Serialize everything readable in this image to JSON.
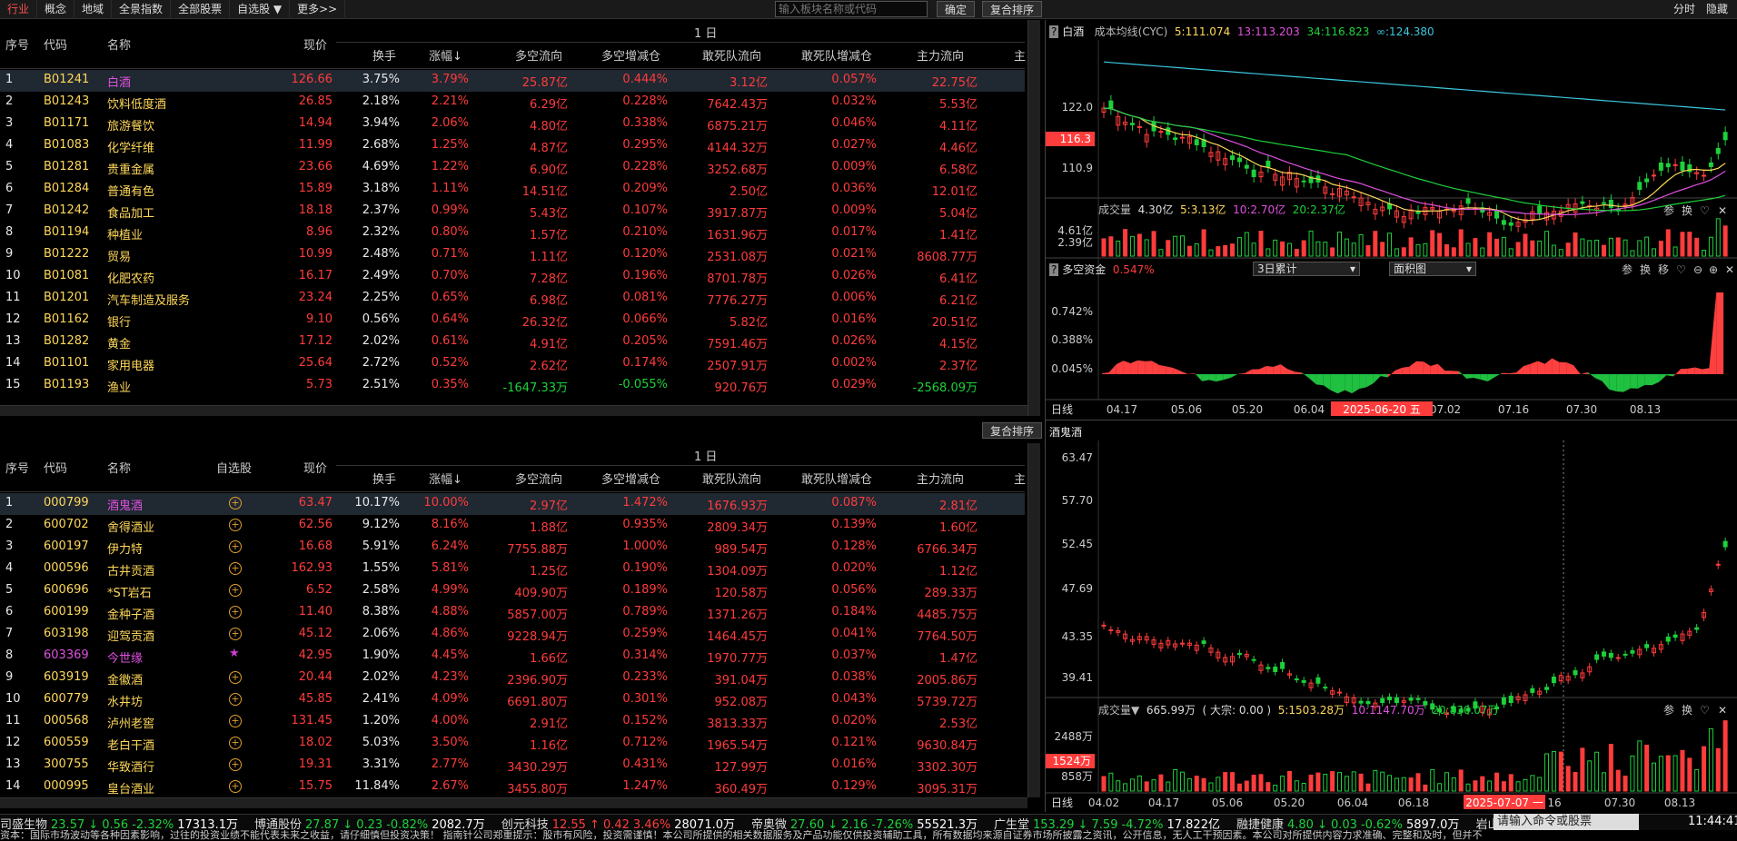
{
  "topbar": {
    "tabs": [
      "行业",
      "概念",
      "地域",
      "全景指数",
      "全部股票",
      "自选股 ▼",
      "更多>>"
    ],
    "search_placeholder": "输入板块名称或代码",
    "confirm": "确定",
    "reset_sort": "复合排序",
    "split": "分时",
    "hide": "隐藏"
  },
  "panel1": {
    "period": "1  日",
    "cols": {
      "seq": "序号",
      "code": "代码",
      "name": "名称",
      "price": "现价",
      "turnover": "换手",
      "change": "涨幅↓",
      "flow": "多空流向",
      "flow_pct": "多空增减仓",
      "dare": "敢死队流向",
      "dare_pct": "敢死队增减仓",
      "main": "主力流向",
      "extra": "主"
    },
    "rows": [
      {
        "seq": "1",
        "code": "B01241",
        "name": "白酒",
        "price": "126.66",
        "turnover": "3.75%",
        "change": "3.79%",
        "flow": "25.87亿",
        "flow_pct": "0.444%",
        "dare": "3.12亿",
        "dare_pct": "0.057%",
        "main": "22.75亿"
      },
      {
        "seq": "2",
        "code": "B01243",
        "name": "饮料低度酒",
        "price": "26.85",
        "turnover": "2.18%",
        "change": "2.21%",
        "flow": "6.29亿",
        "flow_pct": "0.228%",
        "dare": "7642.43万",
        "dare_pct": "0.032%",
        "main": "5.53亿"
      },
      {
        "seq": "3",
        "code": "B01171",
        "name": "旅游餐饮",
        "price": "14.94",
        "turnover": "3.94%",
        "change": "2.06%",
        "flow": "4.80亿",
        "flow_pct": "0.338%",
        "dare": "6875.21万",
        "dare_pct": "0.046%",
        "main": "4.11亿"
      },
      {
        "seq": "4",
        "code": "B01083",
        "name": "化学纤维",
        "price": "11.99",
        "turnover": "2.68%",
        "change": "1.25%",
        "flow": "4.87亿",
        "flow_pct": "0.295%",
        "dare": "4144.32万",
        "dare_pct": "0.027%",
        "main": "4.46亿"
      },
      {
        "seq": "5",
        "code": "B01281",
        "name": "贵重金属",
        "price": "23.66",
        "turnover": "4.69%",
        "change": "1.22%",
        "flow": "6.90亿",
        "flow_pct": "0.228%",
        "dare": "3252.68万",
        "dare_pct": "0.009%",
        "main": "6.58亿"
      },
      {
        "seq": "6",
        "code": "B01284",
        "name": "普通有色",
        "price": "15.89",
        "turnover": "3.18%",
        "change": "1.11%",
        "flow": "14.51亿",
        "flow_pct": "0.209%",
        "dare": "2.50亿",
        "dare_pct": "0.036%",
        "main": "12.01亿"
      },
      {
        "seq": "7",
        "code": "B01242",
        "name": "食品加工",
        "price": "18.18",
        "turnover": "2.37%",
        "change": "0.99%",
        "flow": "5.43亿",
        "flow_pct": "0.107%",
        "dare": "3917.87万",
        "dare_pct": "0.009%",
        "main": "5.04亿"
      },
      {
        "seq": "8",
        "code": "B01194",
        "name": "种植业",
        "price": "8.96",
        "turnover": "2.32%",
        "change": "0.80%",
        "flow": "1.57亿",
        "flow_pct": "0.210%",
        "dare": "1631.96万",
        "dare_pct": "0.017%",
        "main": "1.41亿"
      },
      {
        "seq": "9",
        "code": "B01222",
        "name": "贸易",
        "price": "10.99",
        "turnover": "2.48%",
        "change": "0.71%",
        "flow": "1.11亿",
        "flow_pct": "0.120%",
        "dare": "2531.08万",
        "dare_pct": "0.021%",
        "main": "8608.77万"
      },
      {
        "seq": "10",
        "code": "B01081",
        "name": "化肥农药",
        "price": "16.17",
        "turnover": "2.49%",
        "change": "0.70%",
        "flow": "7.28亿",
        "flow_pct": "0.196%",
        "dare": "8701.78万",
        "dare_pct": "0.026%",
        "main": "6.41亿"
      },
      {
        "seq": "11",
        "code": "B01201",
        "name": "汽车制造及服务",
        "price": "23.24",
        "turnover": "2.25%",
        "change": "0.65%",
        "flow": "6.98亿",
        "flow_pct": "0.081%",
        "dare": "7776.27万",
        "dare_pct": "0.006%",
        "main": "6.21亿"
      },
      {
        "seq": "12",
        "code": "B01162",
        "name": "银行",
        "price": "9.10",
        "turnover": "0.56%",
        "change": "0.64%",
        "flow": "26.32亿",
        "flow_pct": "0.066%",
        "dare": "5.82亿",
        "dare_pct": "0.016%",
        "main": "20.51亿"
      },
      {
        "seq": "13",
        "code": "B01282",
        "name": "黄金",
        "price": "17.12",
        "turnover": "2.02%",
        "change": "0.61%",
        "flow": "4.91亿",
        "flow_pct": "0.205%",
        "dare": "7591.46万",
        "dare_pct": "0.026%",
        "main": "4.15亿"
      },
      {
        "seq": "14",
        "code": "B01101",
        "name": "家用电器",
        "price": "25.64",
        "turnover": "2.72%",
        "change": "0.52%",
        "flow": "2.62亿",
        "flow_pct": "0.174%",
        "dare": "2507.91万",
        "dare_pct": "0.002%",
        "main": "2.37亿"
      },
      {
        "seq": "15",
        "code": "B01193",
        "name": "渔业",
        "price": "5.73",
        "turnover": "2.51%",
        "change": "0.35%",
        "flow": "-1647.33万",
        "flow_pct": "-0.055%",
        "dare": "920.76万",
        "dare_pct": "0.029%",
        "main": "-2568.09万"
      }
    ]
  },
  "panel2": {
    "reset_sort": "复合排序",
    "period": "1  日",
    "cols": {
      "seq": "序号",
      "code": "代码",
      "name": "名称",
      "watch": "自选股",
      "price": "现价",
      "turnover": "换手",
      "change": "涨幅↓",
      "flow": "多空流向",
      "flow_pct": "多空增减仓",
      "dare": "敢死队流向",
      "dare_pct": "敢死队增减仓",
      "main": "主力流向",
      "extra": "主"
    },
    "rows": [
      {
        "seq": "1",
        "code": "000799",
        "name": "酒鬼酒",
        "price": "63.47",
        "turnover": "10.17%",
        "change": "10.00%",
        "flow": "2.97亿",
        "flow_pct": "1.472%",
        "dare": "1676.93万",
        "dare_pct": "0.087%",
        "main": "2.81亿"
      },
      {
        "seq": "2",
        "code": "600702",
        "name": "舍得酒业",
        "price": "62.56",
        "turnover": "9.12%",
        "change": "8.16%",
        "flow": "1.88亿",
        "flow_pct": "0.935%",
        "dare": "2809.34万",
        "dare_pct": "0.139%",
        "main": "1.60亿"
      },
      {
        "seq": "3",
        "code": "600197",
        "name": "伊力特",
        "price": "16.68",
        "turnover": "5.91%",
        "change": "6.24%",
        "flow": "7755.88万",
        "flow_pct": "1.000%",
        "dare": "989.54万",
        "dare_pct": "0.128%",
        "main": "6766.34万"
      },
      {
        "seq": "4",
        "code": "000596",
        "name": "古井贡酒",
        "price": "162.93",
        "turnover": "1.55%",
        "change": "5.81%",
        "flow": "1.25亿",
        "flow_pct": "0.190%",
        "dare": "1304.09万",
        "dare_pct": "0.020%",
        "main": "1.12亿"
      },
      {
        "seq": "5",
        "code": "600696",
        "name": "*ST岩石",
        "price": "6.52",
        "turnover": "2.58%",
        "change": "4.99%",
        "flow": "409.90万",
        "flow_pct": "0.189%",
        "dare": "120.58万",
        "dare_pct": "0.056%",
        "main": "289.33万"
      },
      {
        "seq": "6",
        "code": "600199",
        "name": "金种子酒",
        "price": "11.40",
        "turnover": "8.38%",
        "change": "4.88%",
        "flow": "5857.00万",
        "flow_pct": "0.789%",
        "dare": "1371.26万",
        "dare_pct": "0.184%",
        "main": "4485.75万"
      },
      {
        "seq": "7",
        "code": "603198",
        "name": "迎驾贡酒",
        "price": "45.12",
        "turnover": "2.06%",
        "change": "4.86%",
        "flow": "9228.94万",
        "flow_pct": "0.259%",
        "dare": "1464.45万",
        "dare_pct": "0.041%",
        "main": "7764.50万"
      },
      {
        "seq": "8",
        "code": "603369",
        "name": "今世缘",
        "price": "42.95",
        "turnover": "1.90%",
        "change": "4.45%",
        "flow": "1.66亿",
        "flow_pct": "0.314%",
        "dare": "1970.77万",
        "dare_pct": "0.037%",
        "main": "1.47亿"
      },
      {
        "seq": "9",
        "code": "603919",
        "name": "金徽酒",
        "price": "20.44",
        "turnover": "2.02%",
        "change": "4.23%",
        "flow": "2396.90万",
        "flow_pct": "0.233%",
        "dare": "391.04万",
        "dare_pct": "0.038%",
        "main": "2005.86万"
      },
      {
        "seq": "10",
        "code": "600779",
        "name": "水井坊",
        "price": "45.85",
        "turnover": "2.41%",
        "change": "4.09%",
        "flow": "6691.80万",
        "flow_pct": "0.301%",
        "dare": "952.08万",
        "dare_pct": "0.043%",
        "main": "5739.72万"
      },
      {
        "seq": "11",
        "code": "000568",
        "name": "泸州老窖",
        "price": "131.45",
        "turnover": "1.20%",
        "change": "4.00%",
        "flow": "2.91亿",
        "flow_pct": "0.152%",
        "dare": "3813.33万",
        "dare_pct": "0.020%",
        "main": "2.53亿"
      },
      {
        "seq": "12",
        "code": "600559",
        "name": "老白干酒",
        "price": "18.02",
        "turnover": "5.03%",
        "change": "3.50%",
        "flow": "1.16亿",
        "flow_pct": "0.712%",
        "dare": "1965.54万",
        "dare_pct": "0.121%",
        "main": "9630.84万"
      },
      {
        "seq": "13",
        "code": "300755",
        "name": "华致酒行",
        "price": "19.31",
        "turnover": "3.31%",
        "change": "2.77%",
        "flow": "3430.29万",
        "flow_pct": "0.431%",
        "dare": "127.99万",
        "dare_pct": "0.016%",
        "main": "3302.30万"
      },
      {
        "seq": "14",
        "code": "000995",
        "name": "皇台酒业",
        "price": "15.75",
        "turnover": "11.84%",
        "change": "2.67%",
        "flow": "3455.80万",
        "flow_pct": "1.247%",
        "dare": "360.49万",
        "dare_pct": "0.129%",
        "main": "3095.31万"
      }
    ]
  },
  "chart_top": {
    "title": "白酒",
    "ma_label": "成本均线(CYC)",
    "ma5": "5:111.074",
    "ma13": "13:113.203",
    "ma34": "34:116.823",
    "mainf": "∞:124.380",
    "y_ticks": [
      "122.0",
      "110.9"
    ],
    "cur_price": "116.3",
    "vol_label": "成交量",
    "vol_val": "4.30亿",
    "vol5": "5:3.13亿",
    "vol10": "10:2.70亿",
    "vol20": "20:2.37亿",
    "vol_ticks": [
      "4.61亿",
      "2.39亿"
    ],
    "flow_label": "多空资金",
    "flow_val": "0.547%",
    "flow_sel1": "3日累计",
    "flow_sel2": "面积图",
    "flow_ticks": [
      "0.742%",
      "0.388%",
      "0.045%"
    ],
    "x_label": "日线",
    "x_ticks": [
      "04.17",
      "05.06",
      "05.20",
      "06.04",
      "06.20",
      "07.02",
      "07.16",
      "07.30",
      "08.13"
    ],
    "cursor_date": "2025-06-20 五",
    "tools": [
      "参",
      "换",
      "移"
    ]
  },
  "chart_bot": {
    "title": "酒鬼酒",
    "y_ticks": [
      "63.47",
      "57.70",
      "52.45",
      "47.69",
      "43.35",
      "39.41"
    ],
    "vol_label": "成交量▼",
    "vol_val": "665.99万",
    "vol_extra": "( 大宗: 0.00 )",
    "vol5": "5:1503.28万",
    "vol10": "10:1147.70万",
    "vol20": "20:830.07万",
    "vol_ticks": [
      "2488万",
      "1524万",
      "858万"
    ],
    "x_label": "日线",
    "x_ticks": [
      "04.02",
      "04.17",
      "05.06",
      "05.20",
      "06.04",
      "06.18",
      "07.02",
      "16",
      "07.30",
      "08.13"
    ],
    "cursor_date": "2025-07-07 一"
  },
  "ticker": [
    {
      "name": "司盛生物",
      "price": "23.57",
      "chg": "↓ 0.56",
      "pct": "-2.32%",
      "amt": "17313.1万",
      "dir": "down"
    },
    {
      "name": "博通股份",
      "price": "27.87",
      "chg": "↓ 0.23",
      "pct": "-0.82%",
      "amt": "2082.7万",
      "dir": "down"
    },
    {
      "name": "创元科技",
      "price": "12.55",
      "chg": "↑ 0.42",
      "pct": "3.46%",
      "amt": "28071.0万",
      "dir": "up"
    },
    {
      "name": "帝奥微",
      "price": "27.60",
      "chg": "↓ 2.16",
      "pct": "-7.26%",
      "amt": "55521.3万",
      "dir": "down"
    },
    {
      "name": "广生堂",
      "price": "153.29",
      "chg": "↓ 7.59",
      "pct": "-4.72%",
      "amt": "17.822亿",
      "dir": "down"
    },
    {
      "name": "融捷健康",
      "price": "4.80",
      "chg": "↓ 0.03",
      "pct": "-0.62%",
      "amt": "5897.0万",
      "dir": "down"
    },
    {
      "name": "岩山科技",
      "price": "",
      "chg": "",
      "pct": "",
      "amt": "",
      "dir": "down"
    }
  ],
  "cmd_placeholder": "请输入命令或股票",
  "clock": "11:44:41",
  "notice": "资本：国际市场波动等各种因素影响，过往的投资业绩不能代表未来之收益，请仔细慎但投资决策！                 指南针公司郑重提示：股市有风险，投资需谨慎！本公司所提供的相关数据服务及产品功能仅供投资辅助工具，所有数据均来源自证券市场所披露之资讯，公开信息，无人工干预因素。本公司对所提供内容力求准确、完整和及时，但并不"
}
